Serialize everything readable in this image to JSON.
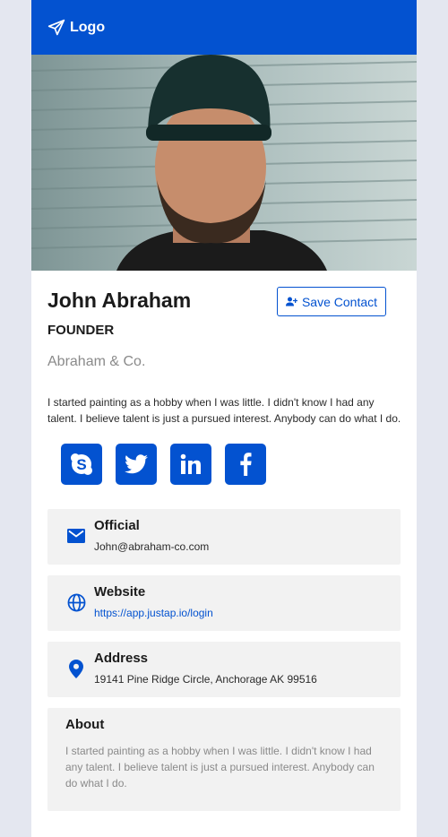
{
  "header": {
    "logo_label": "Logo"
  },
  "profile": {
    "name": "John Abraham",
    "title": "FOUNDER",
    "company": "Abraham & Co.",
    "bio": "I started painting as a hobby when I was little. I didn't know I had any talent. I believe talent is just a pursued interest. Anybody can do what I do.",
    "save_label": "Save Contact"
  },
  "socials": [
    "skype-icon",
    "twitter-icon",
    "linkedin-icon",
    "facebook-icon"
  ],
  "contacts": [
    {
      "label": "Official",
      "value": "John@abraham-co.com",
      "icon": "mail-icon"
    },
    {
      "label": "Website",
      "value": "https://app.justap.io/login",
      "icon": "globe-icon"
    },
    {
      "label": "Address",
      "value": "19141 Pine Ridge Circle, Anchorage AK 99516",
      "icon": "location-pin-icon"
    }
  ],
  "about": {
    "label": "About",
    "text": "I started painting as a hobby when I was little. I didn't know I had any talent. I believe talent is just a pursued interest. Anybody can do what I do."
  },
  "colors": {
    "brand": "#0352d0",
    "background": "#e4e7f0",
    "panel": "#f2f2f2"
  }
}
